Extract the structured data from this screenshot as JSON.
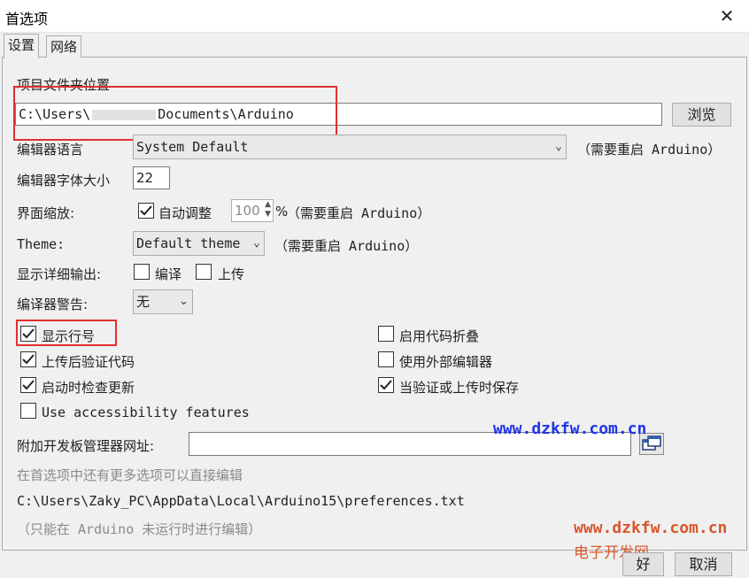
{
  "window": {
    "title": "首选项",
    "close_glyph": "✕"
  },
  "tabs": [
    {
      "label": "设置"
    },
    {
      "label": "网络"
    }
  ],
  "sketchbook": {
    "label": "项目文件夹位置",
    "path_prefix": "C:\\Users\\",
    "path_suffix": "Documents\\Arduino",
    "browse_label": "浏览"
  },
  "editor_language": {
    "label": "编辑器语言",
    "value": "System Default",
    "note": "（需要重启 Arduino）"
  },
  "font_size": {
    "label": "编辑器字体大小",
    "value": "22"
  },
  "interface_scale": {
    "label": "界面缩放:",
    "auto_label": "自动调整",
    "auto_checked": true,
    "percent_value": "100",
    "percent_sign": "%",
    "note": "（需要重启 Arduino）"
  },
  "theme": {
    "label": "Theme:",
    "value": "Default theme",
    "note": "（需要重启 Arduino）"
  },
  "verbose": {
    "label": "显示详细输出:",
    "compile_label": "编译",
    "upload_label": "上传",
    "compile_checked": false,
    "upload_checked": false
  },
  "compiler_warnings": {
    "label": "编译器警告:",
    "value": "无"
  },
  "options": {
    "line_numbers": {
      "label": "显示行号",
      "checked": true
    },
    "verify_after_upload": {
      "label": "上传后验证代码",
      "checked": true
    },
    "check_updates": {
      "label": "启动时检查更新",
      "checked": true
    },
    "accessibility": {
      "label": "Use accessibility features",
      "checked": false
    },
    "code_folding": {
      "label": "启用代码折叠",
      "checked": false
    },
    "external_editor": {
      "label": "使用外部编辑器",
      "checked": false
    },
    "save_on_verify": {
      "label": "当验证或上传时保存",
      "checked": true
    }
  },
  "board_urls": {
    "label": "附加开发板管理器网址:",
    "value": ""
  },
  "more_prefs": {
    "hint": "在首选项中还有更多选项可以直接编辑",
    "file_path": "C:\\Users\\Zaky_PC\\AppData\\Local\\Arduino15\\preferences.txt",
    "note": "（只能在 Arduino 未运行时进行编辑）"
  },
  "watermarks": {
    "site1": "www.dzkfw.com.cn",
    "site2": "www.dzkfw.com.cn",
    "site_name": "电子开发网"
  },
  "buttons": {
    "ok": "好",
    "cancel": "取消"
  },
  "colors": {
    "highlight_box": "#e03030",
    "watermark_blue": "#1f35e8",
    "watermark_orange": "#d7572a"
  }
}
